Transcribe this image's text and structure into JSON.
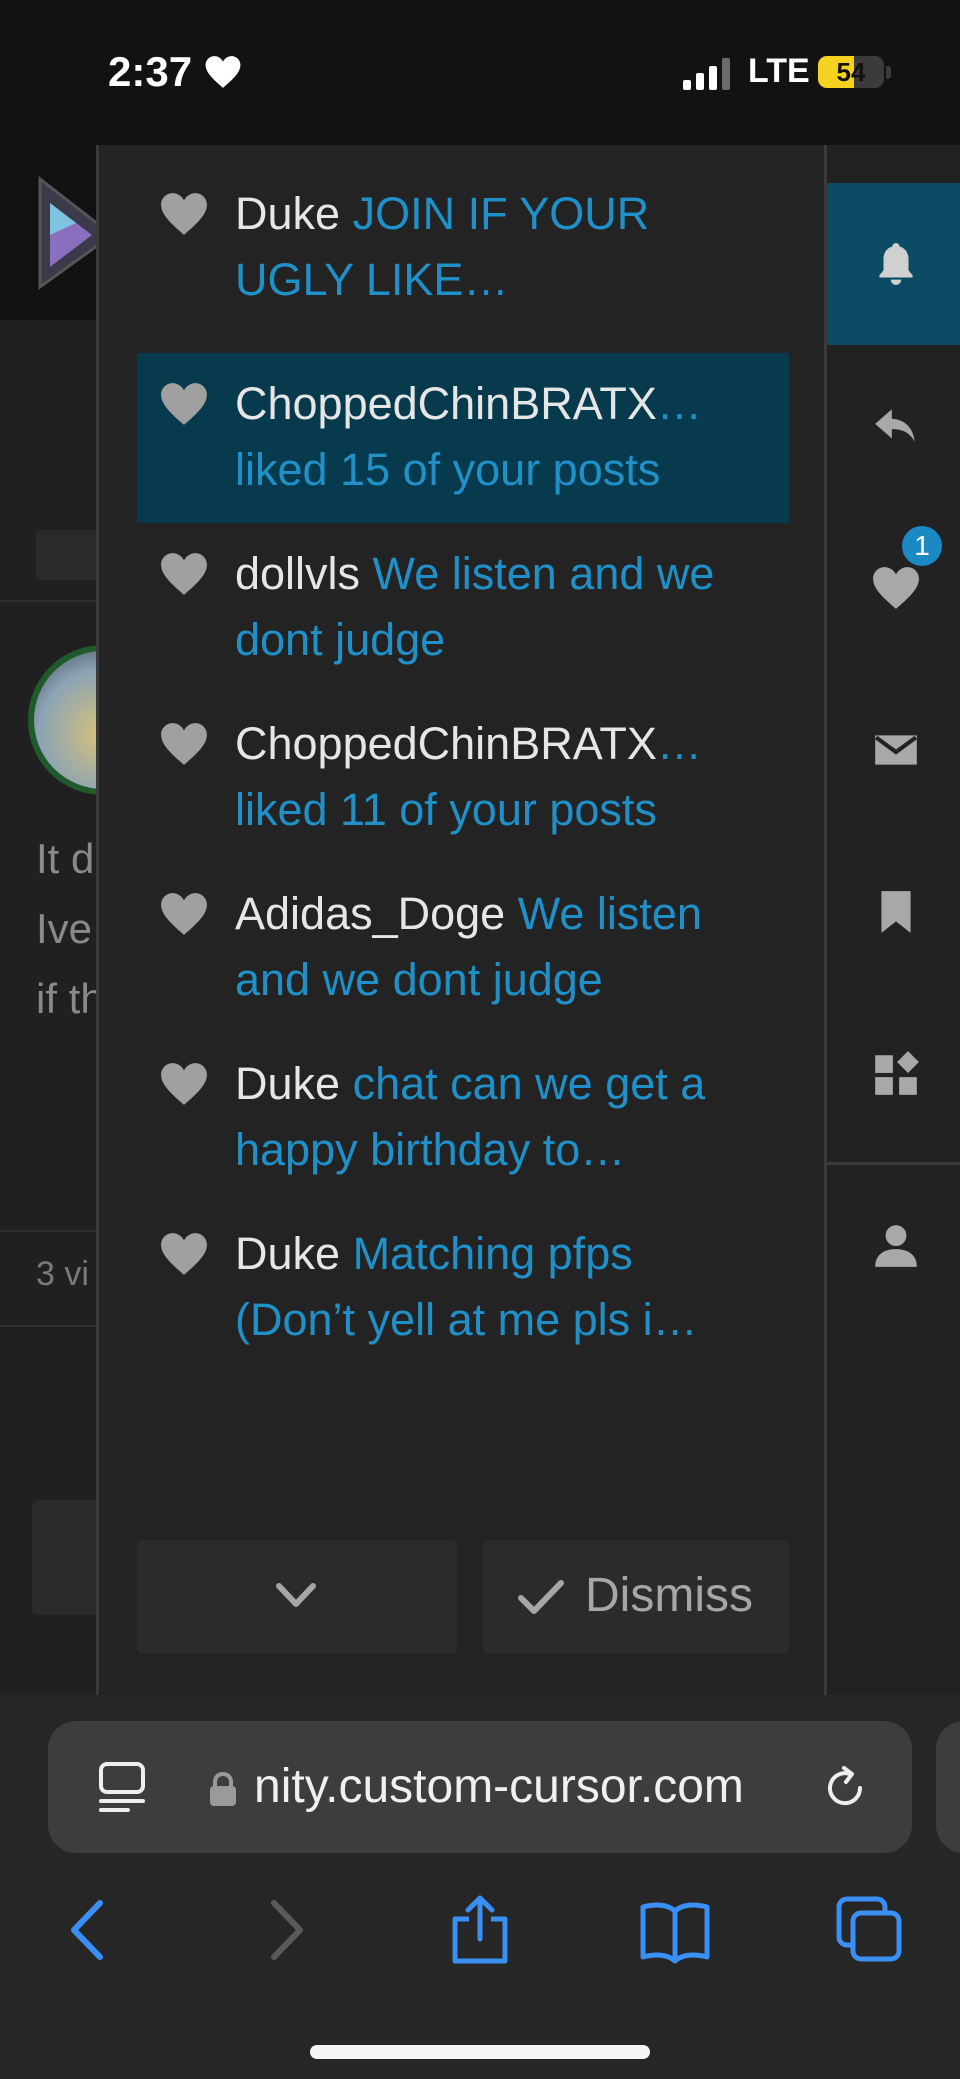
{
  "status_bar": {
    "time": "2:37",
    "network": "LTE",
    "battery": "54",
    "battery_level": 0.54,
    "battery_color": "#f4d21f"
  },
  "background_page": {
    "text_lines": [
      "It d",
      "Ive",
      "if th"
    ],
    "views": "3 vi"
  },
  "notifications": [
    {
      "user": "Duke",
      "message": " JOIN IF YOUR UGLY LIKE…",
      "active": false
    },
    {
      "user": "ChoppedChinBRATX",
      "message": "… liked 15 of your posts",
      "active": true
    },
    {
      "user": "dollvls",
      "message": " We listen and we dont judge",
      "active": false
    },
    {
      "user": "ChoppedChinBRATX",
      "message": "… liked 11 of your posts",
      "active": false
    },
    {
      "user": "Adidas_Doge",
      "message": " We listen and we dont judge",
      "active": false
    },
    {
      "user": "Duke",
      "message": " chat can we get a happy birthday to…",
      "active": false
    },
    {
      "user": "Duke",
      "message": " Matching pfps (Don’t yell at me pls i…",
      "active": false
    }
  ],
  "footer": {
    "dismiss_label": "Dismiss"
  },
  "rail": {
    "items": [
      "bell-icon",
      "reply-icon",
      "heart-icon",
      "envelope-icon",
      "bookmark-icon",
      "widgets-icon",
      "person-icon"
    ],
    "likes_badge": "1"
  },
  "browser": {
    "url": "nity.custom-cursor.com"
  },
  "colors": {
    "accent": "#1f90c8",
    "active_bg": "#073a4c",
    "rail_active": "#0b4b63",
    "browser_blue": "#3a8ff5"
  }
}
